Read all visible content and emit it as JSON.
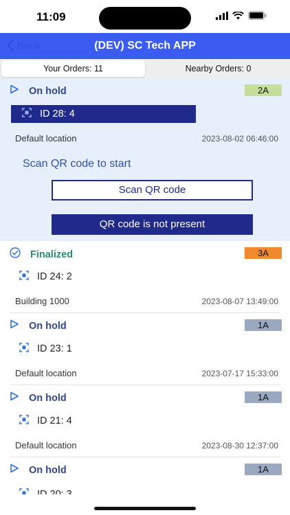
{
  "status_bar": {
    "time": "11:09"
  },
  "nav": {
    "back_label": "Back",
    "title": "(DEV) SC Tech APP"
  },
  "tabs": [
    {
      "label": "Your Orders: 11",
      "active": true
    },
    {
      "label": "Nearby Orders: 0",
      "active": false
    }
  ],
  "colors": {
    "nav": "#3b5cf0",
    "primary_dark": "#1f2a8a",
    "expanded_bg": "#e7effb"
  },
  "orders": [
    {
      "status": "On hold",
      "status_icon": "play-outline-icon",
      "priority": "2A",
      "priority_color": "#c5df9a",
      "id": "ID 28: 4",
      "location": "Default location",
      "timestamp": "2023-08-02 06:46:00",
      "expanded": true
    },
    {
      "status": "Finalized",
      "status_icon": "check-circle-icon",
      "priority": "3A",
      "priority_color": "#f08a2c",
      "id": "ID 24: 2",
      "location": "Building 1000",
      "timestamp": "2023-08-07 13:49:00"
    },
    {
      "status": "On hold",
      "status_icon": "play-outline-icon",
      "priority": "1A",
      "priority_color": "#9aa9c0",
      "id": "ID 23: 1",
      "location": "Default location",
      "timestamp": "2023-07-17 15:33:00"
    },
    {
      "status": "On hold",
      "status_icon": "play-outline-icon",
      "priority": "1A",
      "priority_color": "#9aa9c0",
      "id": "ID 21: 4",
      "location": "Default location",
      "timestamp": "2023-08-30 12:37:00"
    },
    {
      "status": "On hold",
      "status_icon": "play-outline-icon",
      "priority": "1A",
      "priority_color": "#9aa9c0",
      "id": "ID 20: 3",
      "location": "",
      "timestamp": ""
    }
  ],
  "expanded_panel": {
    "scan_hint": "Scan QR code to start",
    "scan_button": "Scan QR code",
    "absent_button": "QR code is not present"
  }
}
